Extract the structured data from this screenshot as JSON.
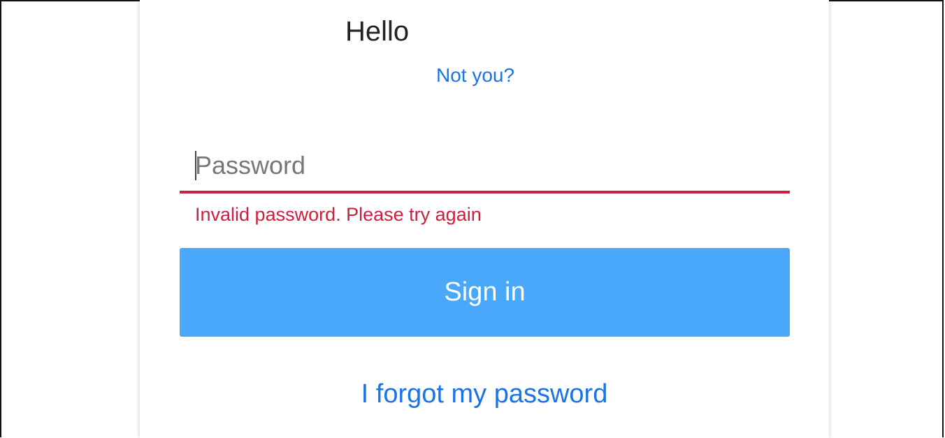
{
  "login": {
    "greeting": "Hello",
    "not_you_link": "Not you?",
    "password_placeholder": "Password",
    "password_value": "",
    "error_message": "Invalid password. Please try again",
    "sign_in_label": "Sign in",
    "forgot_password_link": "I forgot my password"
  },
  "colors": {
    "link": "#1a73e8",
    "error": "#cc1f3b",
    "button_bg": "#4aa8fb",
    "button_text": "#ffffff",
    "text": "#222222"
  }
}
